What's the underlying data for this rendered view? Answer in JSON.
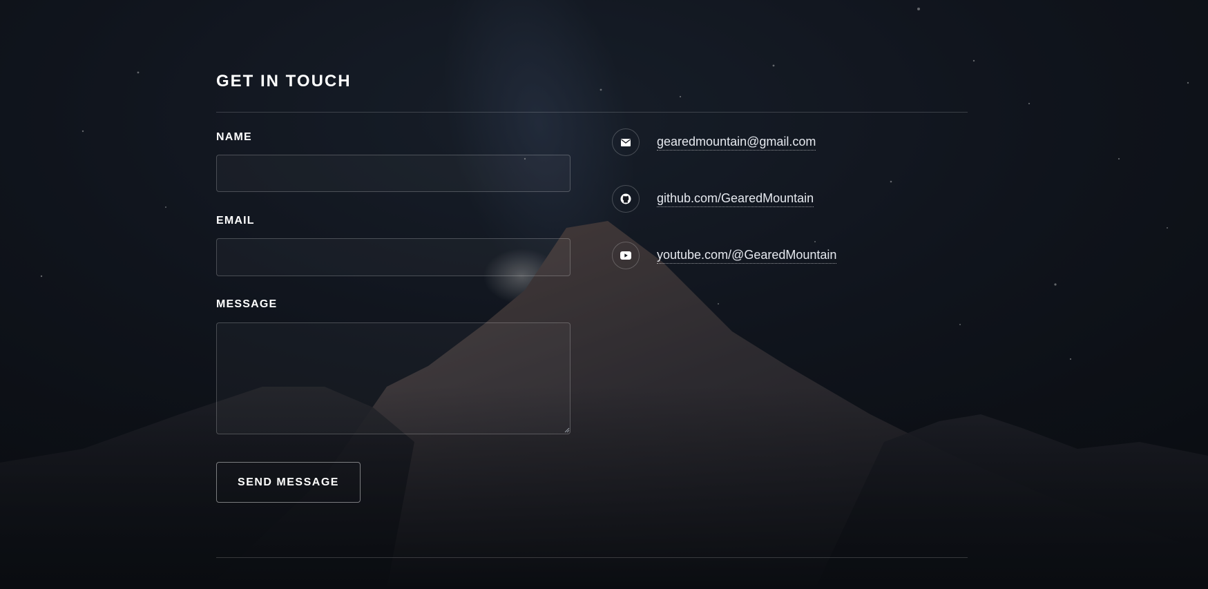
{
  "contact": {
    "title": "GET IN TOUCH",
    "form": {
      "name_label": "NAME",
      "name_value": "",
      "email_label": "EMAIL",
      "email_value": "",
      "message_label": "MESSAGE",
      "message_value": "",
      "send_label": "SEND MESSAGE"
    },
    "links": [
      {
        "icon": "envelope-icon",
        "text": "gearedmountain@gmail.com"
      },
      {
        "icon": "github-icon",
        "text": "github.com/GearedMountain"
      },
      {
        "icon": "youtube-icon",
        "text": "youtube.com/@GearedMountain"
      }
    ]
  },
  "colors": {
    "background": "#0d1017",
    "text": "#ffffff",
    "border": "#3a3d44"
  }
}
